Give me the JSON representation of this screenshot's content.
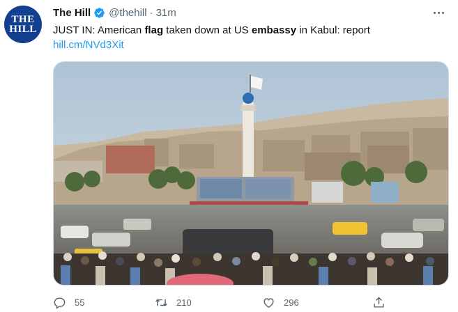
{
  "account": {
    "avatar_line1": "THE",
    "avatar_line2": "HILL",
    "name": "The Hill",
    "handle": "@thehill",
    "separator": "·",
    "time": "31m"
  },
  "tweet": {
    "text_part1": "JUST IN: American ",
    "text_bold1": "flag",
    "text_part2": " taken down at US ",
    "text_bold2": "embassy",
    "text_part3": " in Kabul: report",
    "link": "hill.cm/NVd3Xit"
  },
  "stats": {
    "replies": "55",
    "retweets": "210",
    "likes": "296"
  },
  "colors": {
    "brand": "#123f90",
    "link": "#1d9bf0",
    "verified": "#1d9bf0",
    "muted": "#536471"
  },
  "icons": [
    "verified-badge-icon",
    "more-icon",
    "reply-icon",
    "retweet-icon",
    "like-icon",
    "share-icon"
  ]
}
